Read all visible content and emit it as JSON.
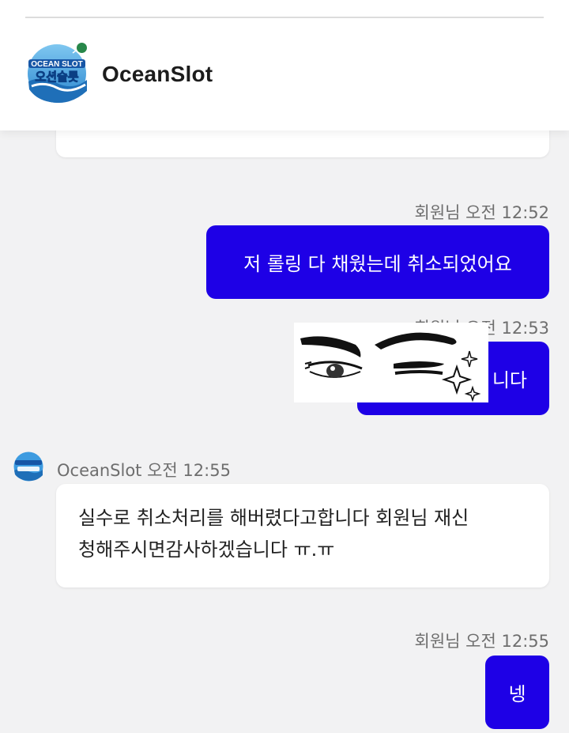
{
  "header": {
    "name": "OceanSlot",
    "logo_text_top": "OCEAN SLOT",
    "logo_text_bottom": "오션슬롯",
    "online_color": "#28874a"
  },
  "colors": {
    "user_bubble": "#1e00e6",
    "bot_bubble": "#ffffff",
    "background": "#f2f2f3"
  },
  "messages": [
    {
      "sender": "회원님",
      "time": "오전 12:52",
      "text": "저 롤링 다 채웠는데 취소되었어요"
    },
    {
      "sender": "회원님",
      "time": "오전 12:53",
      "text_visible": "니다"
    },
    {
      "sender": "OceanSlot",
      "time": "오전 12:55",
      "text_line1": "실수로 취소처리를 해버렸다고합니다 회원님 재신",
      "text_line2": "청해주시면감사하겠습니다 ㅠ.ㅠ"
    },
    {
      "sender": "회원님",
      "time": "오전 12:55",
      "text": "넹"
    }
  ],
  "sticker": {
    "name": "winking-eyes-sticker"
  }
}
